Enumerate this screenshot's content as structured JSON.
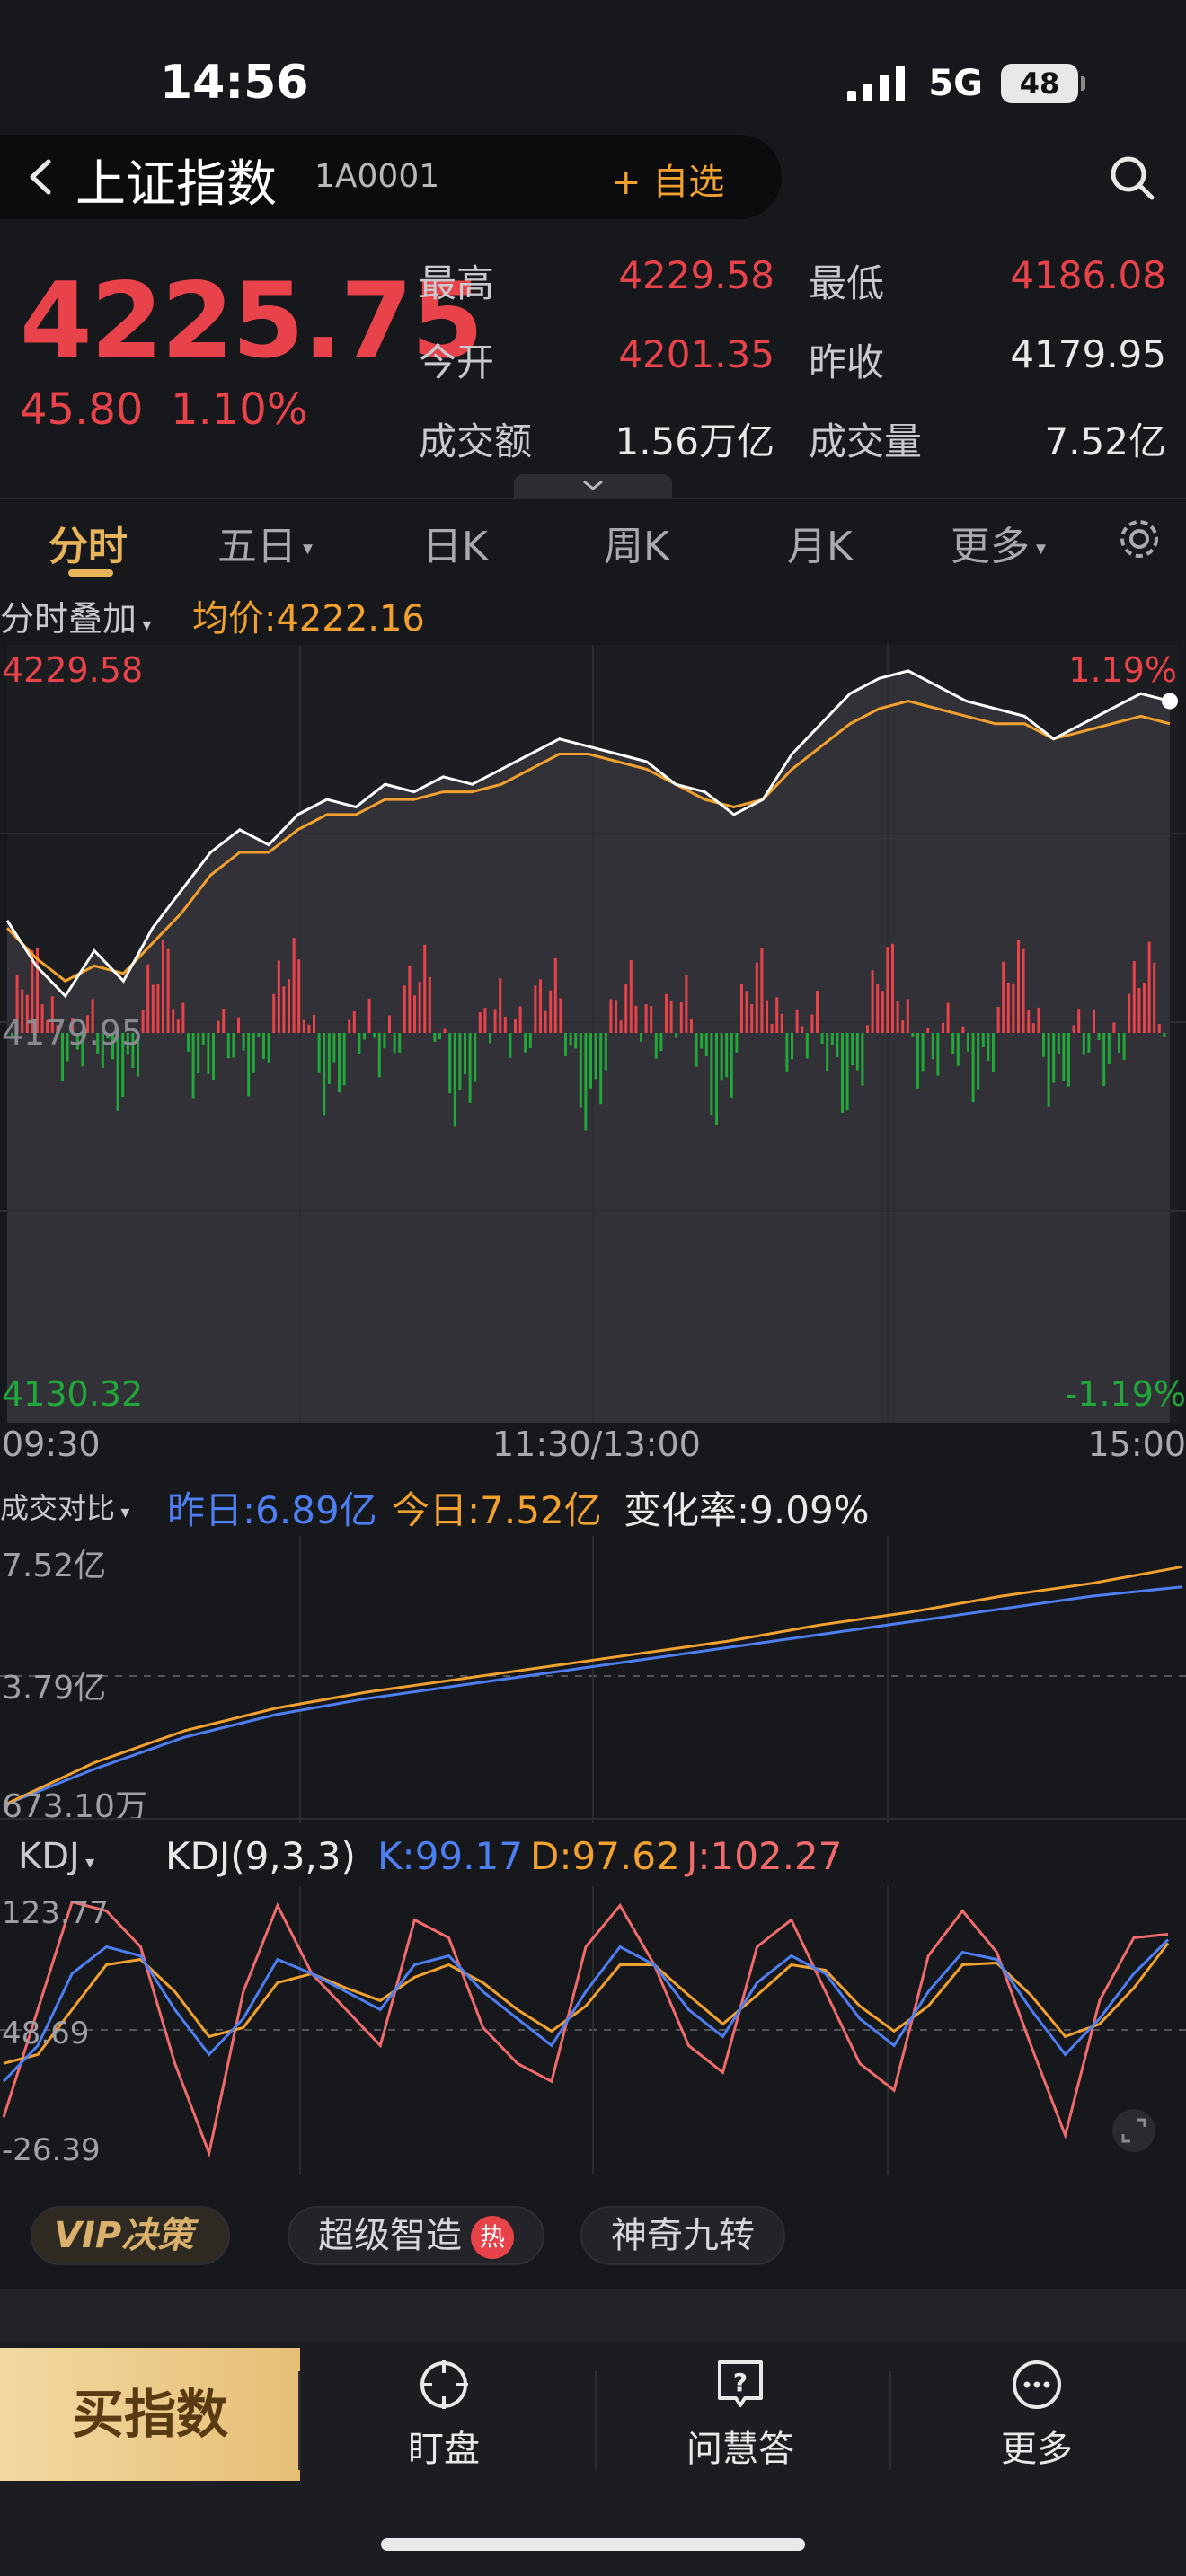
{
  "status": {
    "time": "14:56",
    "network": "5G",
    "battery": "48"
  },
  "header": {
    "title": "上证指数",
    "code": "1A0001",
    "add_watch": "+ 自选"
  },
  "quote": {
    "price": "4225.75",
    "change": "45.80",
    "change_pct": "1.10%",
    "high_label": "最高",
    "high": "4229.58",
    "low_label": "最低",
    "low": "4186.08",
    "open_label": "今开",
    "open": "4201.35",
    "prev_close_label": "昨收",
    "prev_close": "4179.95",
    "amount_label": "成交额",
    "amount": "1.56万亿",
    "volume_label": "成交量",
    "volume": "7.52亿"
  },
  "tabs": [
    {
      "label": "分时"
    },
    {
      "label": "五日"
    },
    {
      "label": "日K"
    },
    {
      "label": "周K"
    },
    {
      "label": "月K"
    },
    {
      "label": "更多"
    }
  ],
  "intraday": {
    "overlay_label": "分时叠加",
    "avg_price": "均价:4222.16",
    "y_high": "4229.58",
    "y_mid": "4179.95",
    "y_low": "4130.32",
    "pct_high": "1.19%",
    "pct_low": "-1.19%",
    "time_start": "09:30",
    "time_mid": "11:30/13:00",
    "time_end": "15:00"
  },
  "volume_compare": {
    "label": "成交对比",
    "yesterday": "昨日:6.89亿",
    "today": "今日:7.52亿",
    "rate": "变化率:9.09%",
    "y_max": "7.52亿",
    "y_mid": "3.79亿",
    "y_min": "673.10万"
  },
  "kdj": {
    "label": "KDJ",
    "params": "KDJ(9,3,3)",
    "k": "K:99.17",
    "d": "D:97.62",
    "j": "J:102.27",
    "y_max": "123.77",
    "y_mid": "48.69",
    "y_min": "-26.39"
  },
  "chips": {
    "vip": "VIP决策",
    "super": "超级智造",
    "hot": "热",
    "nine": "神奇九转"
  },
  "bottom_nav": {
    "buy": "买指数",
    "items": [
      {
        "label": "盯盘"
      },
      {
        "label": "问慧答"
      },
      {
        "label": "更多"
      }
    ]
  },
  "colors": {
    "up": "#e8424a",
    "down": "#22a83a",
    "avg": "#f2a12e",
    "yesterday": "#4d7ef2",
    "background": "#17181c"
  },
  "chart_data": [
    {
      "type": "line",
      "series": [
        {
          "name": "价格",
          "values": [
            4196,
            4190,
            4186,
            4192,
            4188,
            4195,
            4200,
            4205,
            4208,
            4206,
            4210,
            4212,
            4211,
            4214,
            4213,
            4215,
            4214,
            4216,
            4218,
            4220,
            4219,
            4218,
            4217,
            4214,
            4213,
            4210,
            4212,
            4218,
            4222,
            4226,
            4228,
            4229,
            4227,
            4225,
            4224,
            4223,
            4220,
            4222,
            4224,
            4226,
            4225
          ]
        },
        {
          "name": "均价",
          "values": [
            4195,
            4191,
            4188,
            4190,
            4189,
            4193,
            4197,
            4202,
            4205,
            4205,
            4208,
            4210,
            4210,
            4212,
            4212,
            4213,
            4213,
            4214,
            4216,
            4218,
            4218,
            4217,
            4216,
            4214,
            4212,
            4211,
            4212,
            4216,
            4219,
            4222,
            4224,
            4225,
            4224,
            4223,
            4222,
            4222,
            4220,
            4221,
            4222,
            4223,
            4222
          ]
        }
      ],
      "ylim": [
        4130.32,
        4229.58
      ]
    },
    {
      "type": "line",
      "series": [
        {
          "name": "昨日",
          "values": [
            0.07,
            1.2,
            2.2,
            2.9,
            3.4,
            3.8,
            4.2,
            4.6,
            5.0,
            5.4,
            5.8,
            6.2,
            6.6,
            6.89
          ]
        },
        {
          "name": "今日",
          "values": [
            0.07,
            1.4,
            2.4,
            3.1,
            3.6,
            4.0,
            4.4,
            4.8,
            5.2,
            5.7,
            6.1,
            6.6,
            7.0,
            7.52
          ]
        }
      ],
      "ylim": [
        0.0673,
        7.52
      ]
    },
    {
      "type": "line",
      "series": [
        {
          "name": "K",
          "values": [
            20,
            40,
            80,
            95,
            90,
            60,
            35,
            55,
            88,
            80,
            70,
            60,
            85,
            90,
            70,
            55,
            40,
            70,
            95,
            85,
            60,
            45,
            75,
            90,
            80,
            55,
            40,
            70,
            92,
            88,
            60,
            35,
            55,
            80,
            99
          ]
        },
        {
          "name": "D",
          "values": [
            30,
            35,
            60,
            85,
            88,
            70,
            45,
            50,
            75,
            80,
            72,
            65,
            78,
            85,
            75,
            60,
            48,
            62,
            85,
            85,
            68,
            52,
            68,
            85,
            82,
            62,
            48,
            62,
            85,
            86,
            68,
            45,
            52,
            72,
            97
          ]
        },
        {
          "name": "J",
          "values": [
            0,
            60,
            120,
            115,
            95,
            30,
            -20,
            70,
            118,
            80,
            60,
            40,
            110,
            100,
            50,
            30,
            20,
            95,
            118,
            85,
            40,
            25,
            95,
            110,
            70,
            30,
            15,
            90,
            115,
            92,
            40,
            -10,
            65,
            100,
            102
          ]
        }
      ],
      "ylim": [
        -26.39,
        123.77
      ]
    }
  ]
}
